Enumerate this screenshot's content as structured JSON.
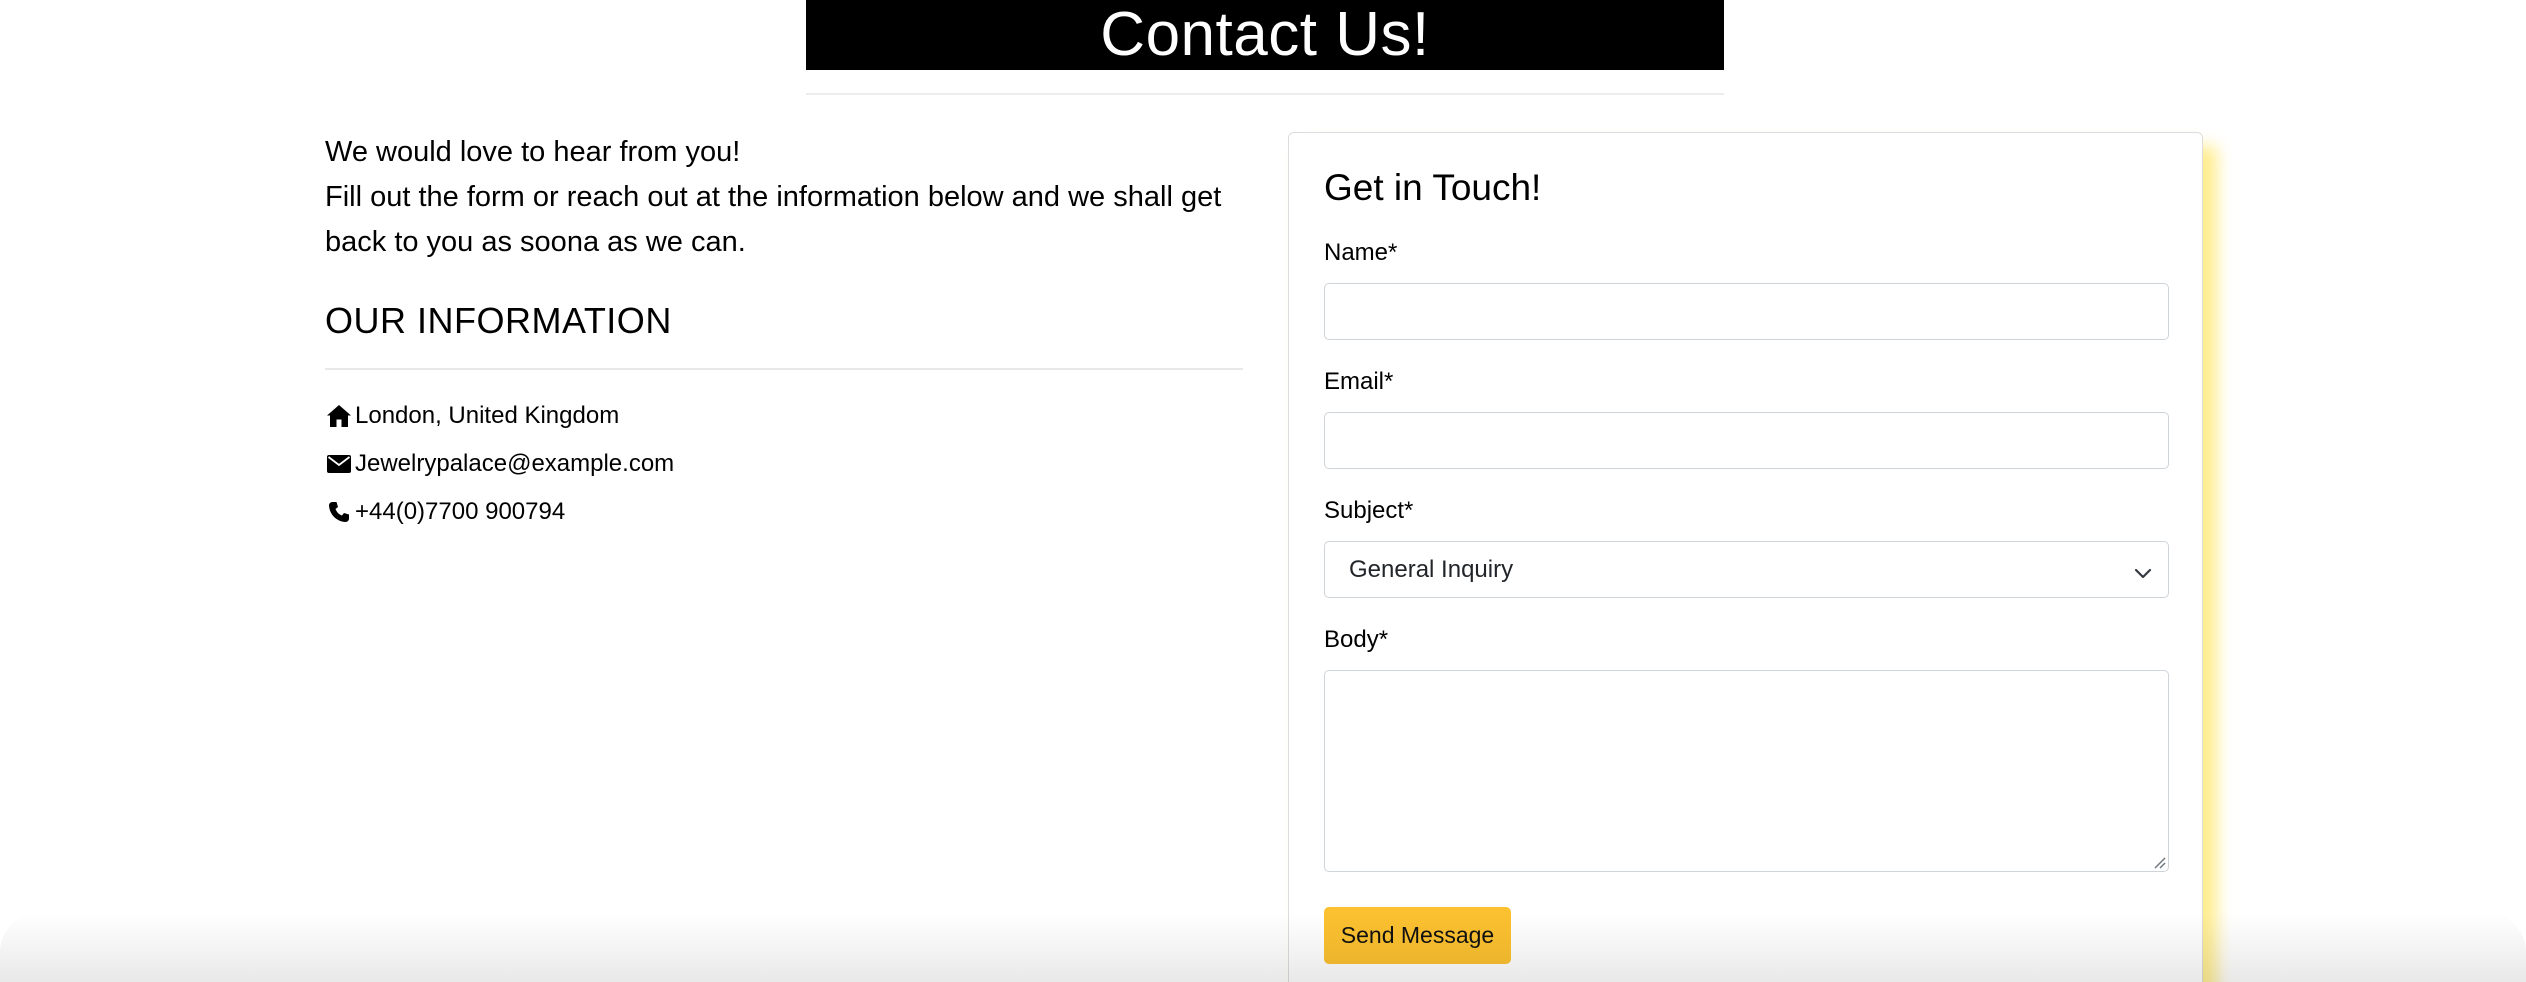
{
  "page_title": "Contact Us!",
  "intro": {
    "line1": "We would love to hear from you!",
    "line2": "Fill out the form or reach out at the information below and we shall get",
    "line3": "back to you as soona as we can."
  },
  "info": {
    "heading": "OUR INFORMATION",
    "items": [
      {
        "icon": "home-icon",
        "text": "London, United Kingdom"
      },
      {
        "icon": "envelope-icon",
        "text": "Jewelrypalace@example.com"
      },
      {
        "icon": "phone-icon",
        "text": "+44(0)7700 900794"
      }
    ]
  },
  "form": {
    "title": "Get in Touch!",
    "name_label": "Name*",
    "name_value": "",
    "email_label": "Email*",
    "email_value": "",
    "subject_label": "Subject*",
    "subject_selected": "General Inquiry",
    "body_label": "Body*",
    "body_value": "",
    "send_label": "Send Message"
  },
  "colors": {
    "banner_bg": "#000000",
    "accent": "#fcc130",
    "card_glow": "#ffd400"
  }
}
